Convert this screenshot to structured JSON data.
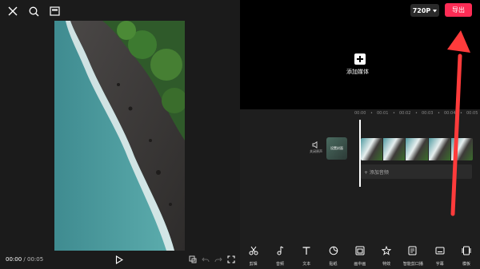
{
  "player": {
    "current_time": "00:00",
    "separator": " / ",
    "total_time": "00:05"
  },
  "header": {
    "resolution": "720P",
    "export_label": "导出"
  },
  "preview": {
    "add_media_label": "添加媒体"
  },
  "timeline": {
    "ruler_ticks": [
      "00:00",
      "•",
      "00:01",
      "•",
      "00:02",
      "•",
      "00:03",
      "•",
      "00:04",
      "•",
      "00:05"
    ],
    "mute_label": "关闭原声",
    "cover_label": "设置封面",
    "add_audio_label": "+ 添加音频"
  },
  "toolbar": {
    "items": [
      {
        "label": "剪辑",
        "icon": "scissors-icon"
      },
      {
        "label": "音频",
        "icon": "music-note-icon"
      },
      {
        "label": "文本",
        "icon": "text-icon"
      },
      {
        "label": "贴纸",
        "icon": "sticker-icon"
      },
      {
        "label": "画中画",
        "icon": "picture-in-picture-icon"
      },
      {
        "label": "特效",
        "icon": "effects-star-icon"
      },
      {
        "label": "智能剪口播",
        "icon": "smart-cut-icon"
      },
      {
        "label": "字幕",
        "icon": "subtitle-icon"
      },
      {
        "label": "模板",
        "icon": "template-icon"
      }
    ]
  },
  "colors": {
    "accent": "#fe2c55",
    "annotation_arrow": "#ff3b3b"
  }
}
